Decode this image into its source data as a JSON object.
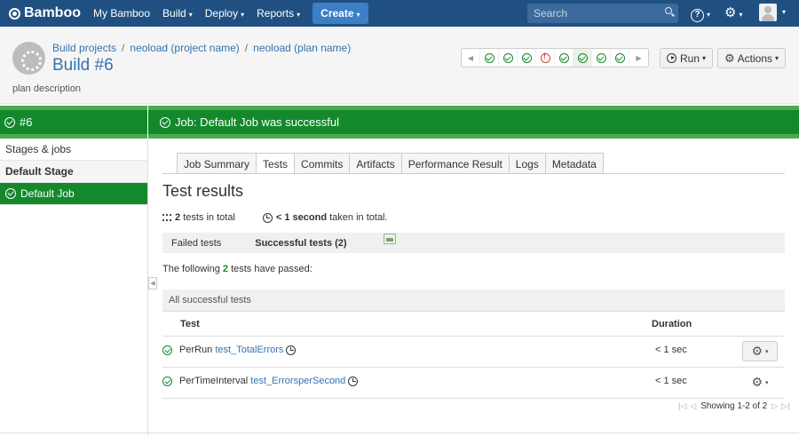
{
  "topnav": {
    "logo": "Bamboo",
    "items": [
      {
        "label": "My Bamboo",
        "dropdown": false
      },
      {
        "label": "Build",
        "dropdown": true
      },
      {
        "label": "Deploy",
        "dropdown": true
      },
      {
        "label": "Reports",
        "dropdown": true
      }
    ],
    "create_label": "Create",
    "search_placeholder": "Search",
    "help_glyph": "?",
    "gear_glyph": "⚙",
    "caret": "▾"
  },
  "header": {
    "breadcrumb": [
      "Build projects",
      "neoload (project name)",
      "neoload (plan name)"
    ],
    "separator": "/",
    "title": "Build #6",
    "description": "plan description",
    "history": [
      "ok",
      "ok",
      "ok",
      "fail",
      "ok",
      "ok",
      "ok",
      "ok"
    ],
    "history_prev": "◀",
    "history_next": "▶",
    "run_label": "Run",
    "actions_label": "Actions"
  },
  "status": {
    "build_number": "#6",
    "job_message": "Job: Default Job was successful"
  },
  "sidebar": {
    "stages_label": "Stages & jobs",
    "stage_name": "Default Stage",
    "job_name": "Default Job",
    "collapse_glyph": "◀"
  },
  "tabs": [
    "Job Summary",
    "Tests",
    "Commits",
    "Artifacts",
    "Performance Result",
    "Logs",
    "Metadata"
  ],
  "active_tab": "Tests",
  "results": {
    "title": "Test results",
    "total_count": "2",
    "total_suffix": "tests in total",
    "duration_bold": "< 1 second",
    "duration_suffix": "taken in total.",
    "filter_failed": "Failed tests",
    "filter_success": "Successful tests (2)",
    "passed_prefix": "The following",
    "passed_count": "2",
    "passed_suffix": "tests have passed:",
    "all_header": "All successful tests",
    "col_test": "Test",
    "col_duration": "Duration",
    "rows": [
      {
        "class": "PerRun",
        "method": "test_TotalErrors",
        "duration": "< 1 sec"
      },
      {
        "class": "PerTimeInterval",
        "method": "test_ErrorsperSecond",
        "duration": "< 1 sec"
      }
    ],
    "pager_text": "Showing 1-2 of 2",
    "pager_first": "|◁",
    "pager_prev": "◁",
    "pager_next": "▷",
    "pager_last": "▷|"
  }
}
